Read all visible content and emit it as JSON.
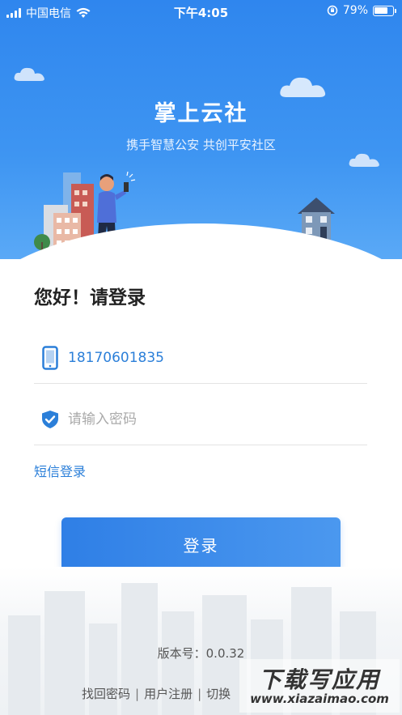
{
  "status_bar": {
    "carrier": "中国电信",
    "time": "下午4:05",
    "battery_text": "79%",
    "battery_level": 0.79,
    "icons": [
      "signal-icon",
      "wifi-icon",
      "rotation-lock-icon",
      "battery-icon"
    ]
  },
  "hero": {
    "title": "掌上云社",
    "slogan": "携手智慧公安 共创平安社区"
  },
  "login": {
    "greeting": "您好！请登录",
    "phone_value": "18170601835",
    "password_placeholder": "请输入密码",
    "sms_login": "短信登录",
    "login_button": "登录"
  },
  "footer": {
    "version": "版本号：0.0.32",
    "links": [
      "找回密码",
      "用户注册",
      "切换"
    ],
    "separator": "|"
  },
  "watermark": {
    "title": "下载写应用",
    "url": "www.xiazaimao.com"
  },
  "colors": {
    "primary": "#2f86ee",
    "link": "#2b7fd9",
    "button": "#3a8bec"
  }
}
